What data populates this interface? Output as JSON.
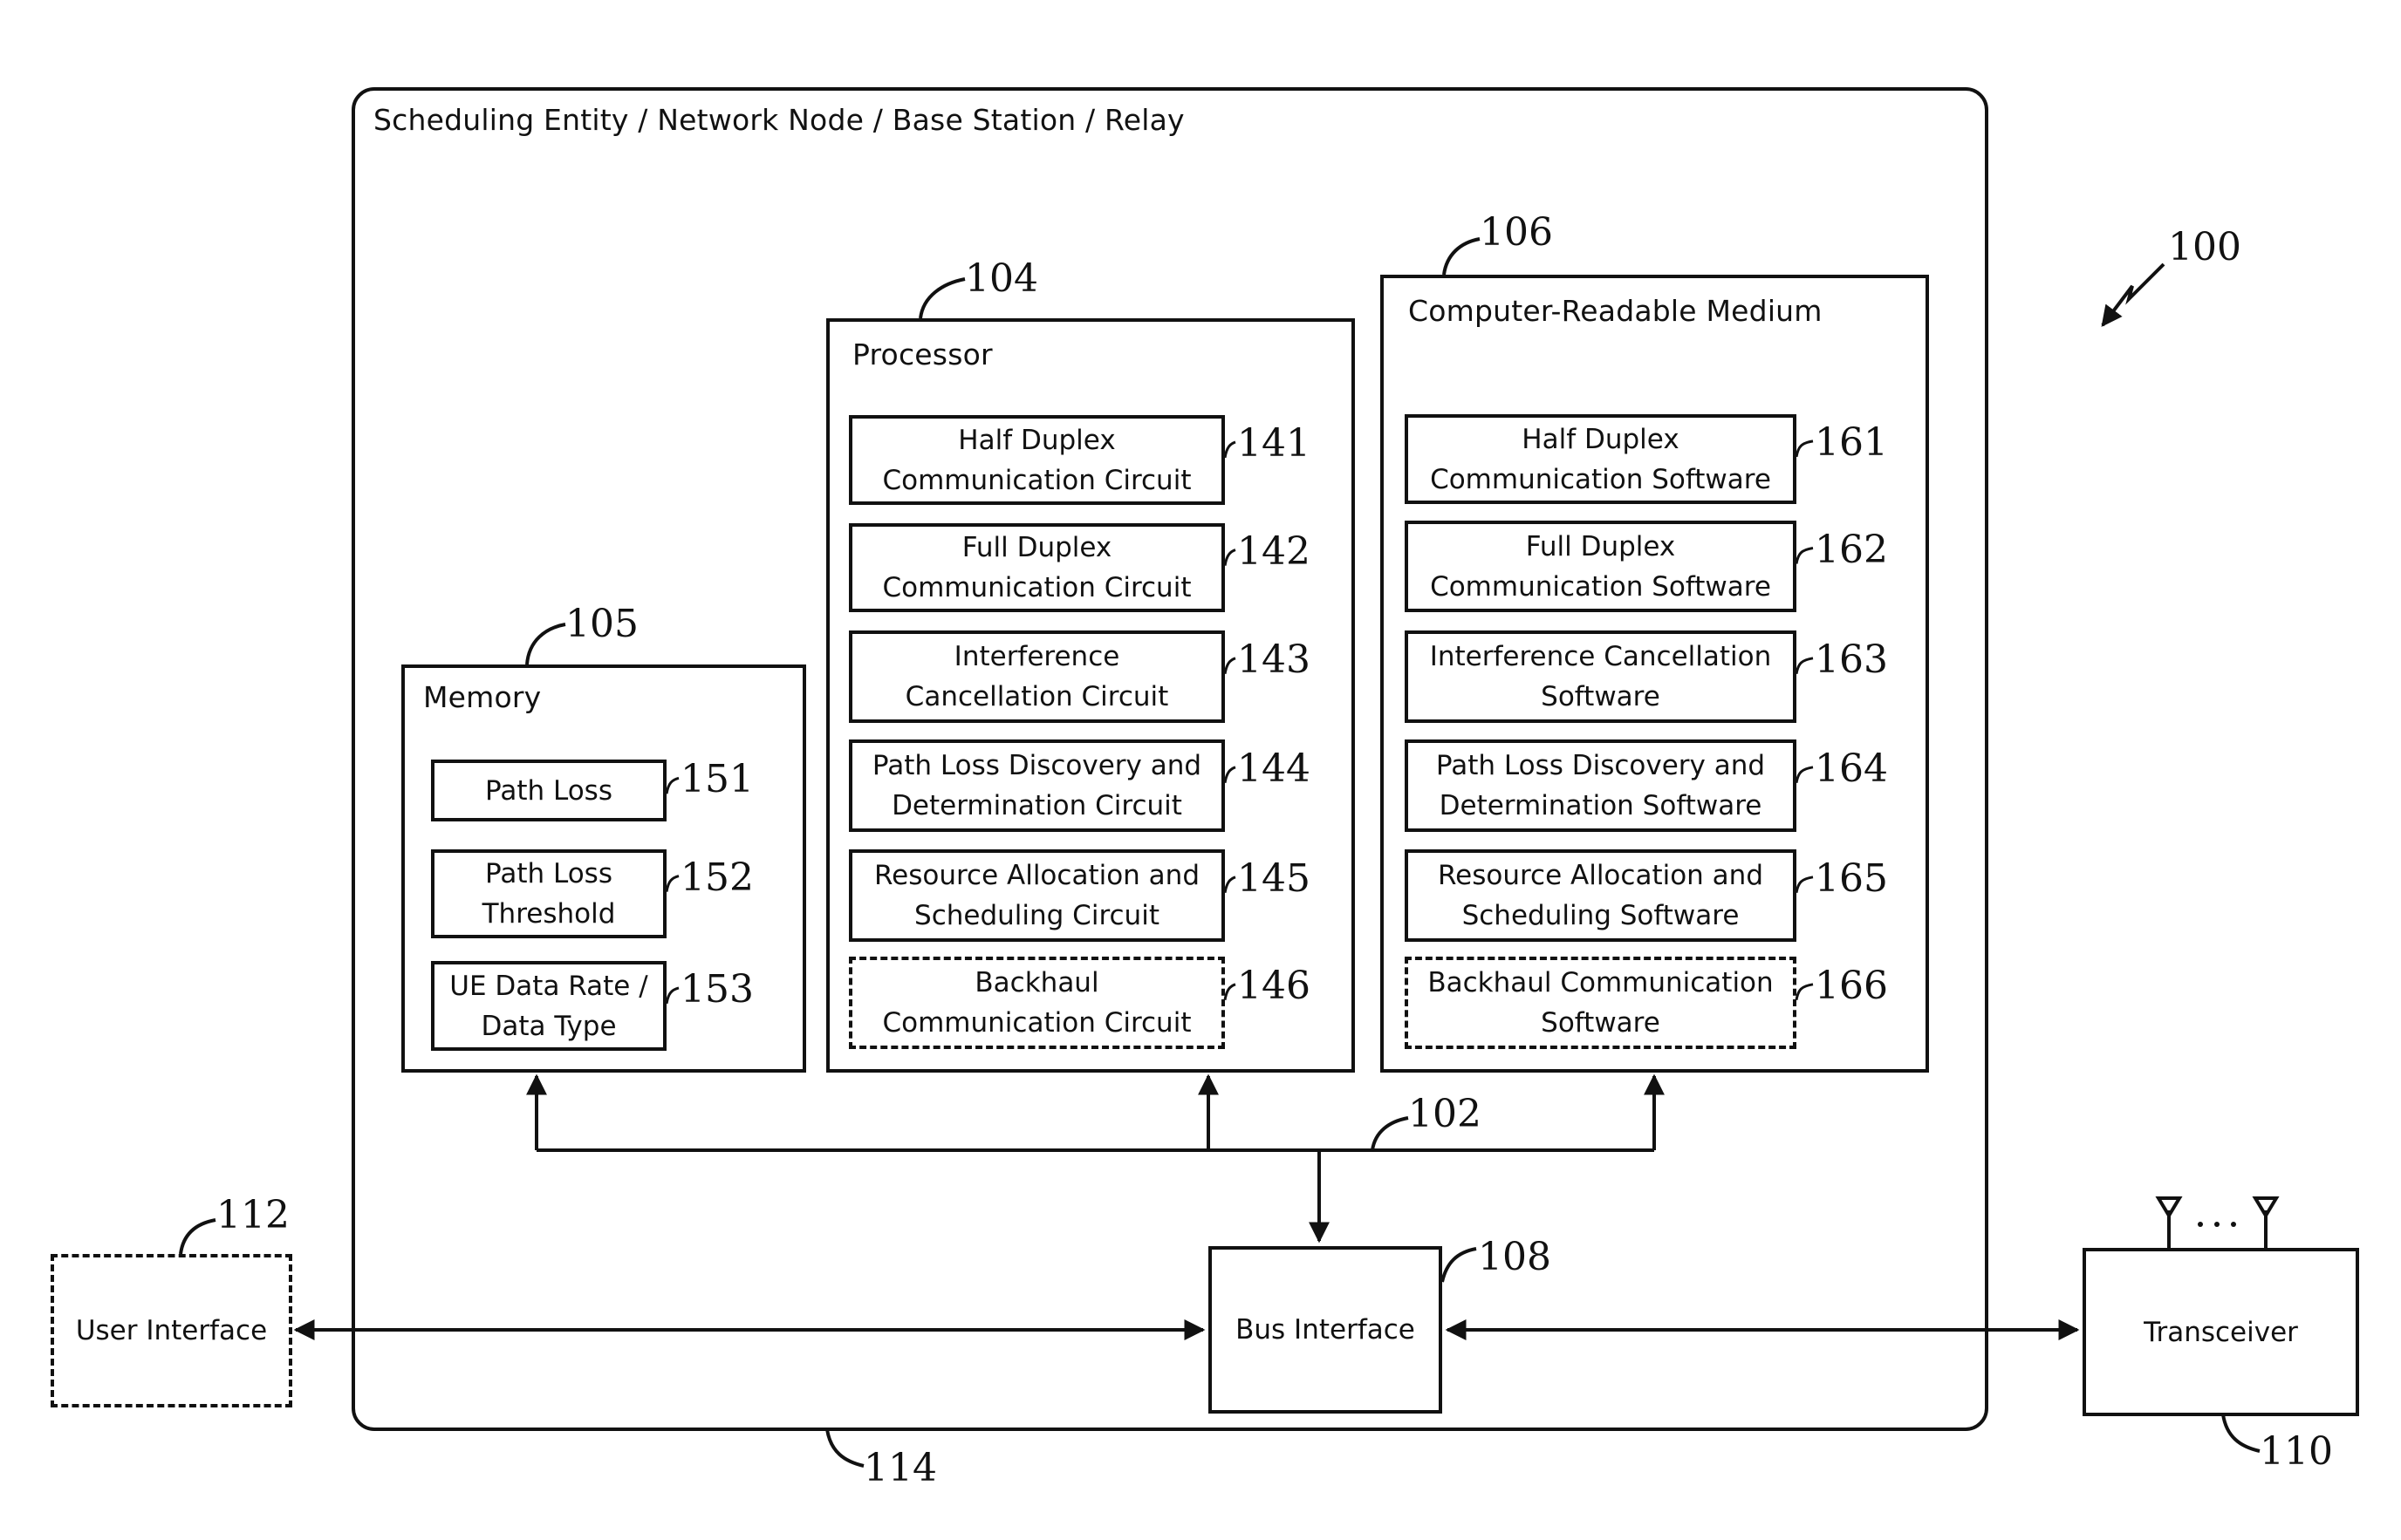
{
  "diagram": {
    "figure_ref": "100",
    "container": {
      "title": "Scheduling Entity / Network Node / Base Station / Relay",
      "ref": "114"
    },
    "bus": {
      "ref": "102"
    },
    "memory": {
      "title": "Memory",
      "ref": "105",
      "items": [
        {
          "lines": [
            "Path Loss"
          ],
          "ref": "151",
          "dashed": false
        },
        {
          "lines": [
            "Path Loss",
            "Threshold"
          ],
          "ref": "152",
          "dashed": false
        },
        {
          "lines": [
            "UE Data Rate /",
            "Data Type"
          ],
          "ref": "153",
          "dashed": false
        }
      ]
    },
    "processor": {
      "title": "Processor",
      "ref": "104",
      "items": [
        {
          "lines": [
            "Half Duplex",
            "Communication Circuit"
          ],
          "ref": "141",
          "dashed": false
        },
        {
          "lines": [
            "Full Duplex",
            "Communication Circuit"
          ],
          "ref": "142",
          "dashed": false
        },
        {
          "lines": [
            "Interference",
            "Cancellation Circuit"
          ],
          "ref": "143",
          "dashed": false
        },
        {
          "lines": [
            "Path Loss Discovery and",
            "Determination Circuit"
          ],
          "ref": "144",
          "dashed": false
        },
        {
          "lines": [
            "Resource Allocation and",
            "Scheduling Circuit"
          ],
          "ref": "145",
          "dashed": false
        },
        {
          "lines": [
            "Backhaul",
            "Communication Circuit"
          ],
          "ref": "146",
          "dashed": true
        }
      ]
    },
    "crm": {
      "title": "Computer-Readable Medium",
      "ref": "106",
      "items": [
        {
          "lines": [
            "Half Duplex",
            "Communication Software"
          ],
          "ref": "161",
          "dashed": false
        },
        {
          "lines": [
            "Full Duplex",
            "Communication Software"
          ],
          "ref": "162",
          "dashed": false
        },
        {
          "lines": [
            "Interference Cancellation",
            "Software"
          ],
          "ref": "163",
          "dashed": false
        },
        {
          "lines": [
            "Path Loss Discovery and",
            "Determination Software"
          ],
          "ref": "164",
          "dashed": false
        },
        {
          "lines": [
            "Resource Allocation and",
            "Scheduling Software"
          ],
          "ref": "165",
          "dashed": false
        },
        {
          "lines": [
            "Backhaul Communication",
            "Software"
          ],
          "ref": "166",
          "dashed": true
        }
      ]
    },
    "bus_interface": {
      "label": "Bus Interface",
      "ref": "108"
    },
    "user_interface": {
      "label": "User Interface",
      "ref": "112",
      "dashed": true
    },
    "transceiver": {
      "label": "Transceiver",
      "ref": "110",
      "antenna_ellipsis": "..."
    }
  }
}
